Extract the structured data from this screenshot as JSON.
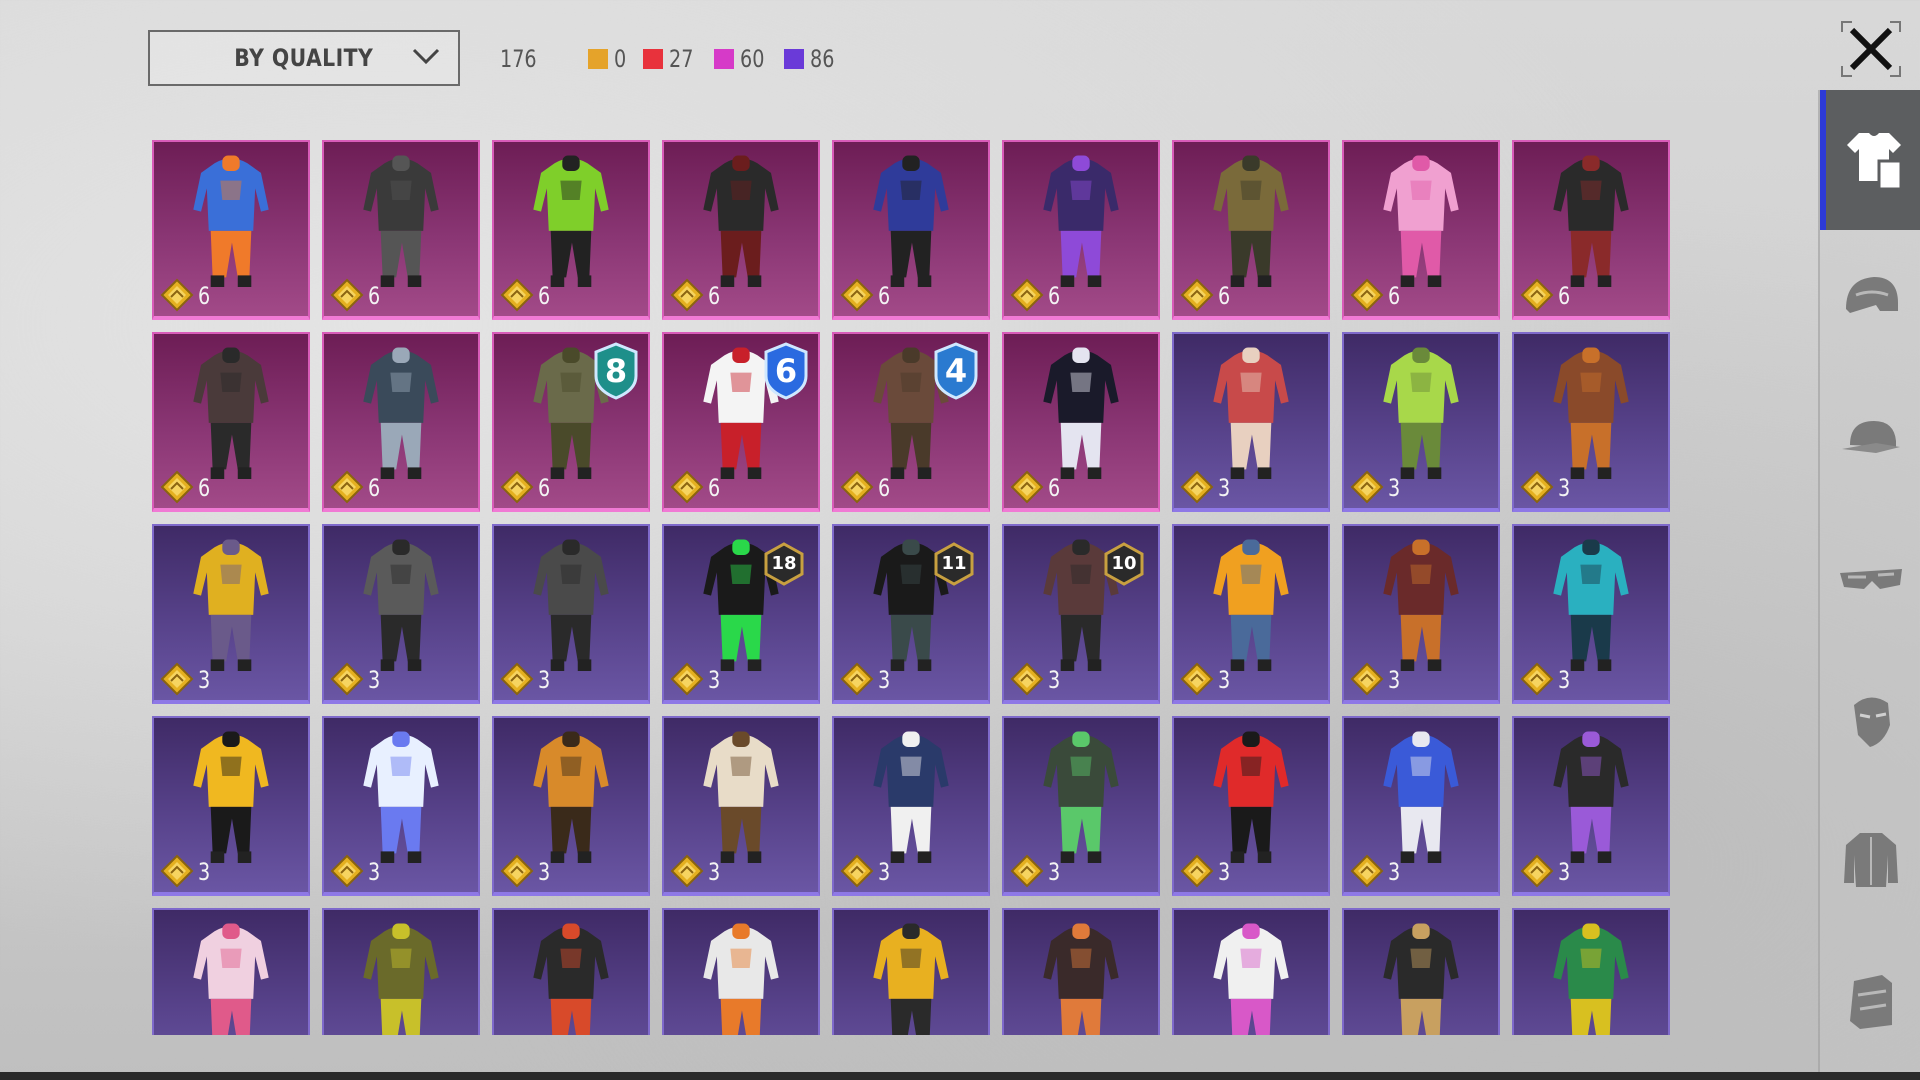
{
  "sort": {
    "label": "BY QUALITY"
  },
  "counts": {
    "total": "176",
    "stats": [
      {
        "color": "#e5a32a",
        "value": "0"
      },
      {
        "color": "#e8323c",
        "value": "27"
      },
      {
        "color": "#d63ac8",
        "value": "60"
      },
      {
        "color": "#6a3ad8",
        "value": "86"
      }
    ]
  },
  "sidebar": {
    "tabs": [
      {
        "icon": "outfit-icon",
        "active": true
      },
      {
        "icon": "helmet-icon",
        "active": false
      },
      {
        "icon": "cap-icon",
        "active": false
      },
      {
        "icon": "goggles-icon",
        "active": false
      },
      {
        "icon": "mask-icon",
        "active": false
      },
      {
        "icon": "jacket-icon",
        "active": false
      },
      {
        "icon": "backpack-icon",
        "active": false
      }
    ]
  },
  "items": [
    {
      "value": "6",
      "quality": "legendary",
      "c1": "#3a6fd8",
      "c2": "#f07a2a"
    },
    {
      "value": "6",
      "quality": "legendary",
      "c1": "#3a3a3a",
      "c2": "#555"
    },
    {
      "value": "6",
      "quality": "legendary",
      "c1": "#7fcf2a",
      "c2": "#222"
    },
    {
      "value": "6",
      "quality": "legendary",
      "c1": "#2a2a2a",
      "c2": "#6b1d1d"
    },
    {
      "value": "6",
      "quality": "legendary",
      "c1": "#2f3b9a",
      "c2": "#222"
    },
    {
      "value": "6",
      "quality": "legendary",
      "c1": "#3a2a6a",
      "c2": "#8e4ad8"
    },
    {
      "value": "6",
      "quality": "legendary",
      "c1": "#7a6a3a",
      "c2": "#3a3a2a"
    },
    {
      "value": "6",
      "quality": "legendary",
      "c1": "#f0a0d0",
      "c2": "#e05aa8"
    },
    {
      "value": "6",
      "quality": "legendary",
      "c1": "#2a2a2a",
      "c2": "#8a2a2a"
    },
    {
      "value": "6",
      "quality": "legendary",
      "c1": "#4a3a3a",
      "c2": "#2a2a2a"
    },
    {
      "value": "6",
      "quality": "legendary",
      "c1": "#3a4a5a",
      "c2": "#9aa8b8"
    },
    {
      "value": "6",
      "quality": "legendary",
      "c1": "#6a6a4a",
      "c2": "#4a4a2a",
      "level": "8",
      "levelColor": "#1e8f8a"
    },
    {
      "value": "6",
      "quality": "legendary",
      "c1": "#f4f4f4",
      "c2": "#c8202a",
      "level": "6",
      "levelColor": "#2a6ae0"
    },
    {
      "value": "6",
      "quality": "legendary",
      "c1": "#6a4a3a",
      "c2": "#4a3a2a",
      "level": "4",
      "levelColor": "#2a7ad0"
    },
    {
      "value": "6",
      "quality": "legendary",
      "c1": "#1a1a2a",
      "c2": "#e4e4f0"
    },
    {
      "value": "3",
      "quality": "epic",
      "c1": "#c84a4a",
      "c2": "#e8d0c0"
    },
    {
      "value": "3",
      "quality": "epic",
      "c1": "#a8d84a",
      "c2": "#6a8a3a"
    },
    {
      "value": "3",
      "quality": "epic",
      "c1": "#8a4a2a",
      "c2": "#c8702a"
    },
    {
      "value": "3",
      "quality": "epic",
      "c1": "#e0b020",
      "c2": "#6a5a8a"
    },
    {
      "value": "3",
      "quality": "epic",
      "c1": "#5a5a5a",
      "c2": "#2a2a2a"
    },
    {
      "value": "3",
      "quality": "epic",
      "c1": "#4a4a4a",
      "c2": "#2a2a2a"
    },
    {
      "value": "3",
      "quality": "epic",
      "c1": "#1a1a1a",
      "c2": "#2ad84a",
      "tier": "18"
    },
    {
      "value": "3",
      "quality": "epic",
      "c1": "#1a1a1a",
      "c2": "#3a4a4a",
      "tier": "11"
    },
    {
      "value": "3",
      "quality": "epic",
      "c1": "#5a3a3a",
      "c2": "#2a2a2a",
      "tier": "10"
    },
    {
      "value": "3",
      "quality": "epic",
      "c1": "#f0a020",
      "c2": "#4a6a9a"
    },
    {
      "value": "3",
      "quality": "epic",
      "c1": "#6a2a2a",
      "c2": "#c8702a"
    },
    {
      "value": "3",
      "quality": "epic",
      "c1": "#2ab0c0",
      "c2": "#1a3a4a"
    },
    {
      "value": "3",
      "quality": "epic",
      "c1": "#f0b820",
      "c2": "#1a1a1a"
    },
    {
      "value": "3",
      "quality": "epic",
      "c1": "#e8f0ff",
      "c2": "#6a7af0"
    },
    {
      "value": "3",
      "quality": "epic",
      "c1": "#d88a2a",
      "c2": "#3a2a1a"
    },
    {
      "value": "3",
      "quality": "epic",
      "c1": "#e8dcc8",
      "c2": "#6a4a2a"
    },
    {
      "value": "3",
      "quality": "epic",
      "c1": "#2a3a6a",
      "c2": "#f0f0f0"
    },
    {
      "value": "3",
      "quality": "epic",
      "c1": "#3a4a3a",
      "c2": "#5ac86a"
    },
    {
      "value": "3",
      "quality": "epic",
      "c1": "#e02a2a",
      "c2": "#1a1a1a"
    },
    {
      "value": "3",
      "quality": "epic",
      "c1": "#3a5ad8",
      "c2": "#e8e8f0"
    },
    {
      "value": "3",
      "quality": "epic",
      "c1": "#2a2a2a",
      "c2": "#9a5ad8"
    },
    {
      "value": "",
      "quality": "epic",
      "c1": "#f0d0e0",
      "c2": "#e05a8a"
    },
    {
      "value": "",
      "quality": "epic",
      "c1": "#6a6a2a",
      "c2": "#c8c02a"
    },
    {
      "value": "",
      "quality": "epic",
      "c1": "#2a2a2a",
      "c2": "#d84a2a"
    },
    {
      "value": "",
      "quality": "epic",
      "c1": "#e8e8e8",
      "c2": "#e87a2a"
    },
    {
      "value": "",
      "quality": "epic",
      "c1": "#e8b020",
      "c2": "#2a2a2a"
    },
    {
      "value": "",
      "quality": "epic",
      "c1": "#3a2a2a",
      "c2": "#e07a3a"
    },
    {
      "value": "",
      "quality": "epic",
      "c1": "#f0f0f0",
      "c2": "#d858c8"
    },
    {
      "value": "",
      "quality": "epic",
      "c1": "#2a2a2a",
      "c2": "#c8a060"
    },
    {
      "value": "",
      "quality": "epic",
      "c1": "#2a8a4a",
      "c2": "#d8c020"
    }
  ]
}
